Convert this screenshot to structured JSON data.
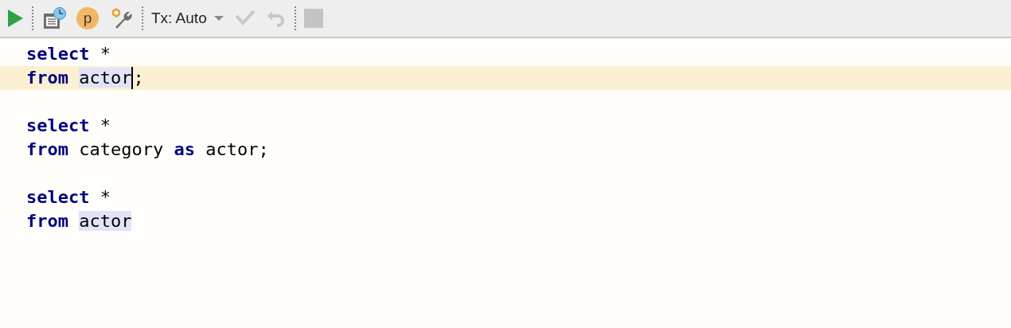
{
  "toolbar": {
    "tools": [
      {
        "kind": "run"
      },
      {
        "kind": "separator"
      },
      {
        "kind": "history"
      },
      {
        "kind": "profile",
        "label": "p"
      },
      {
        "kind": "settings"
      },
      {
        "kind": "separator"
      },
      {
        "kind": "tx",
        "label": "Tx: Auto"
      },
      {
        "kind": "commit",
        "disabled": true
      },
      {
        "kind": "rollback",
        "disabled": true
      },
      {
        "kind": "separator"
      },
      {
        "kind": "stop",
        "disabled": true
      }
    ]
  },
  "editor": {
    "lines": [
      {
        "current": false,
        "tokens": [
          {
            "kind": "keyword",
            "text": "select",
            "highlighted": false
          },
          {
            "kind": "operator",
            "text": "*",
            "highlighted": false
          }
        ]
      },
      {
        "current": true,
        "tokens": [
          {
            "kind": "keyword",
            "text": "from",
            "highlighted": false
          },
          {
            "kind": "identifier",
            "text": "actor",
            "highlighted": true
          },
          {
            "kind": "caret"
          },
          {
            "kind": "punct",
            "text": ";",
            "highlighted": false
          }
        ]
      },
      {
        "current": false
      },
      {
        "current": false,
        "tokens": [
          {
            "kind": "keyword",
            "text": "select",
            "highlighted": false
          },
          {
            "kind": "operator",
            "text": "*",
            "highlighted": false
          }
        ]
      },
      {
        "current": false,
        "tokens": [
          {
            "kind": "keyword",
            "text": "from",
            "highlighted": false
          },
          {
            "kind": "identifier",
            "text": "category",
            "highlighted": false
          },
          {
            "kind": "keyword",
            "text": "as",
            "highlighted": false
          },
          {
            "kind": "identifier",
            "text": "actor",
            "highlighted": false
          },
          {
            "kind": "punct",
            "text": ";",
            "highlighted": false
          }
        ]
      },
      {
        "current": false
      },
      {
        "current": false,
        "tokens": [
          {
            "kind": "keyword",
            "text": "select",
            "highlighted": false
          },
          {
            "kind": "operator",
            "text": "*",
            "highlighted": false
          }
        ]
      },
      {
        "current": false,
        "tokens": [
          {
            "kind": "keyword",
            "text": "from",
            "highlighted": false
          },
          {
            "kind": "identifier",
            "text": "actor",
            "highlighted": true
          }
        ]
      }
    ]
  }
}
